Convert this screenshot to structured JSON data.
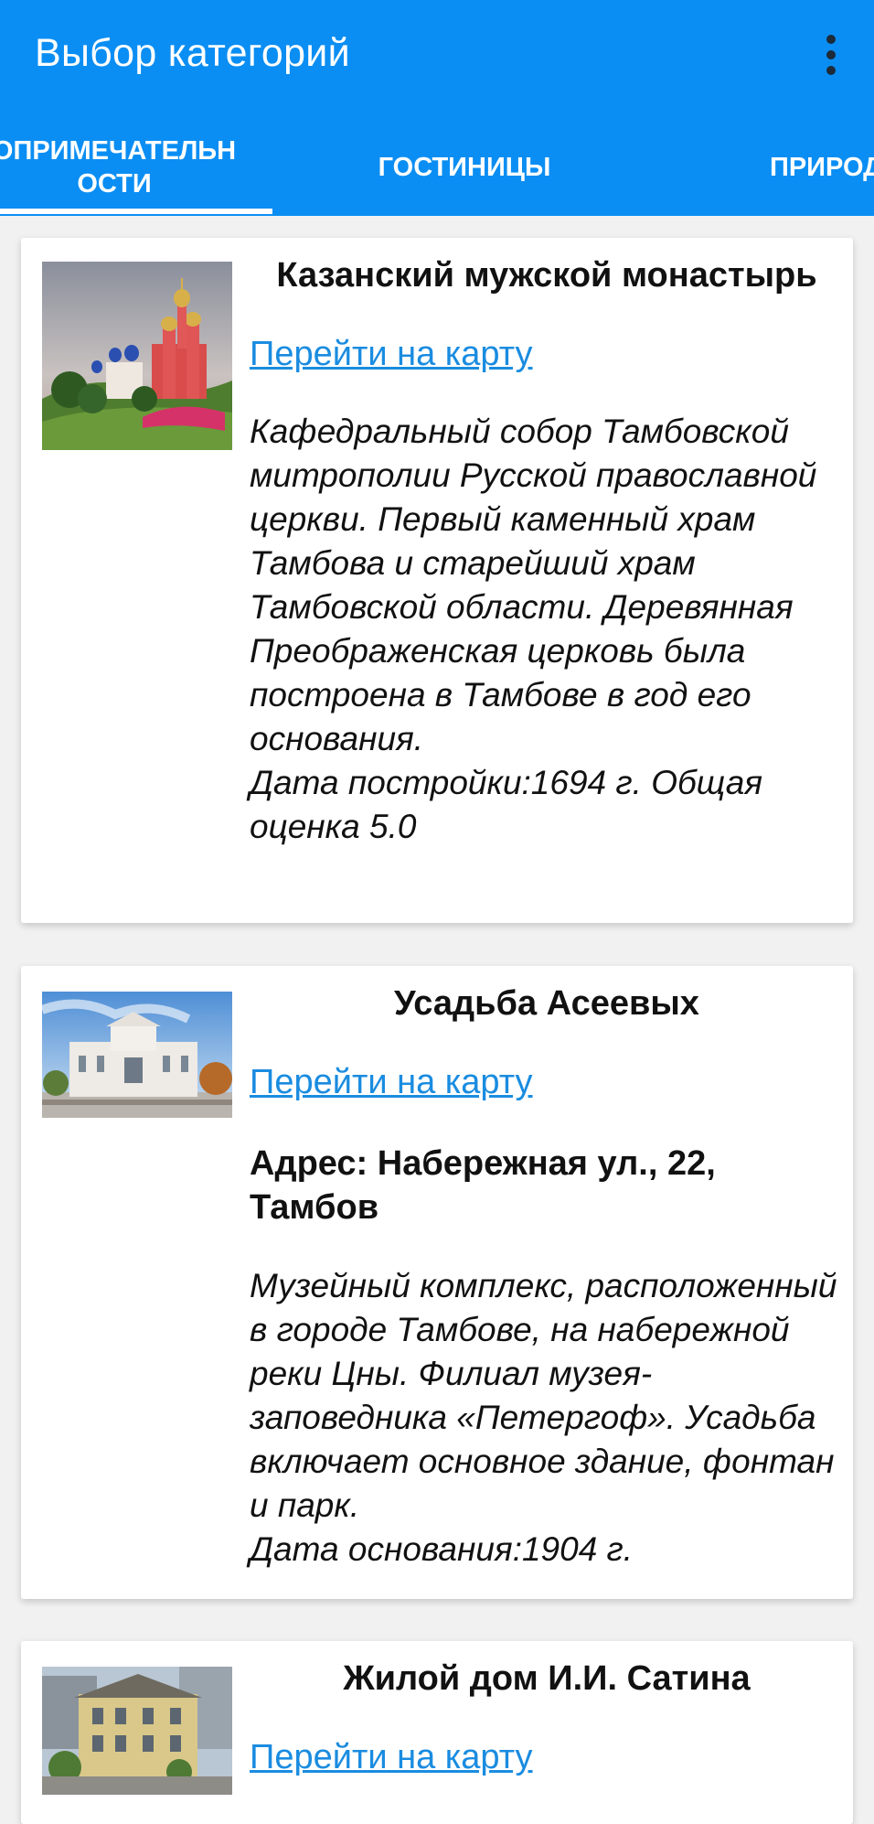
{
  "appbar": {
    "title": "Выбор категорий",
    "menu_icon": "more-vert-icon"
  },
  "tabs": [
    {
      "label": "ОПРИМЕЧАТЕЛЬН\nОСТИ",
      "selected": true
    },
    {
      "label": "ГОСТИНИЦЫ",
      "selected": false
    },
    {
      "label": "ПРИРОД",
      "selected": false
    }
  ],
  "places": [
    {
      "title": "Казанский мужской монастырь",
      "map_link": "Перейти на карту",
      "description": "Кафедральный собор Тамбовской митрополии Русской православной церкви. Первый каменный храм Тамбова и старейший храм Тамбовской области. Деревянная Преображенская церковь была построена в Тамбове в год его основания.\nДата постройки:1694 г.  Общая оценка 5.0"
    },
    {
      "title": "Усадьба Асеевых",
      "map_link": "Перейти на карту",
      "address": "Адрес: Набережная ул., 22, Тамбов",
      "description": "Музейный комплекс, расположенный в городе Тамбове, на набережной реки Цны. Филиал музея-заповедника «Петергоф». Усадьба включает основное здание, фонтан и парк.\nДата основания:1904 г."
    },
    {
      "title": "Жилой дом И.И. Сатина",
      "map_link": "Перейти на карту"
    }
  ],
  "colors": {
    "appbar": "#0b8ef3",
    "link": "#1a8ce0",
    "background": "#f1f1f1"
  }
}
